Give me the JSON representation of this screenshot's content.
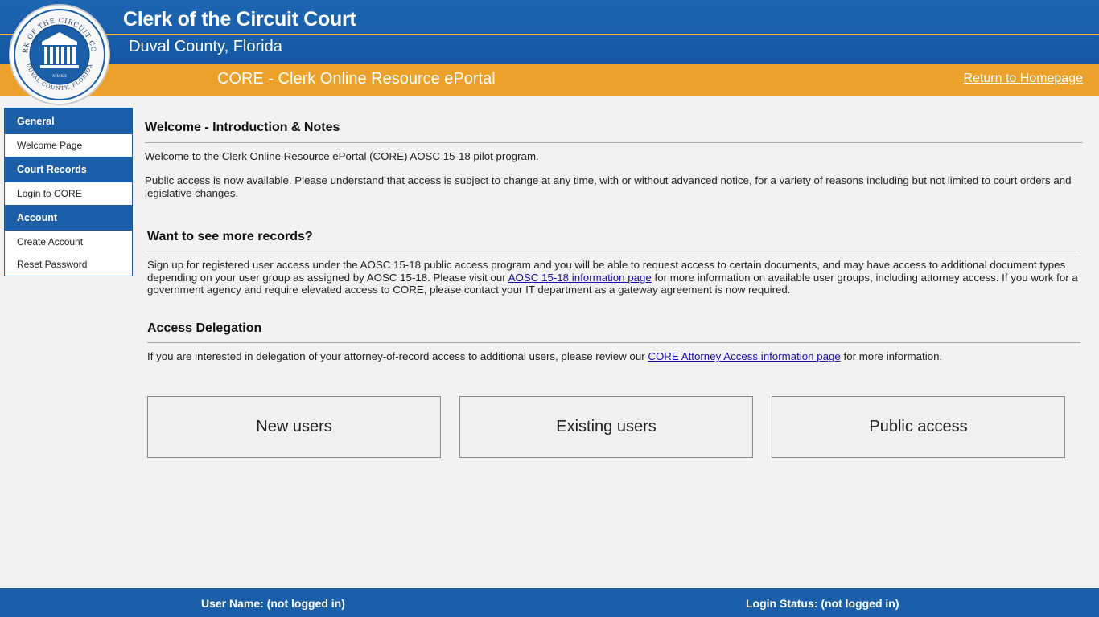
{
  "header": {
    "title": "Clerk of the Circuit Court",
    "subtitle": "Duval County, Florida",
    "portal_title": "CORE - Clerk Online Resource ePortal",
    "home_link": "Return to Homepage",
    "seal_text_top": "CLERK OF THE CIRCUIT COURT",
    "seal_text_bottom": "DUVAL COUNTY, FLORIDA",
    "seal_year": "MMXII"
  },
  "sidebar": {
    "sections": [
      {
        "title": "General",
        "items": [
          "Welcome Page"
        ]
      },
      {
        "title": "Court Records",
        "items": [
          "Login to CORE"
        ]
      },
      {
        "title": "Account",
        "items": [
          "Create Account",
          "Reset Password"
        ]
      }
    ]
  },
  "welcome": {
    "title": "Welcome - Introduction & Notes",
    "p1": "Welcome to the Clerk Online Resource ePortal (CORE) AOSC 15-18 pilot program.",
    "p2": "Public access is now available. Please understand that access is subject to change at any time, with or without advanced notice, for a variety of reasons including but not limited to court orders and legislative changes."
  },
  "records": {
    "title": "Want to see more records?",
    "p_before": "Sign up for registered user access under the AOSC 15-18 public access program and you will be able to request access to certain documents, and may have access to additional document types depending on your user group as assigned by AOSC 15-18. Please visit our ",
    "link": "AOSC 15-18 information page",
    "p_after": " for more information on available user groups, including attorney access. If you work for a government agency and require elevated access to CORE, please contact your IT department as a gateway agreement is now required."
  },
  "delegation": {
    "title": "Access Delegation",
    "p_before": "If you are interested in delegation of your attorney-of-record access to additional users, please review our ",
    "link": "CORE Attorney Access information page",
    "p_after": " for more information."
  },
  "buttons": {
    "new_users": "New users",
    "existing_users": "Existing users",
    "public_access": "Public access"
  },
  "footer": {
    "user_name": "User Name: (not logged in)",
    "login_status": "Login Status: (not logged in)"
  },
  "colors": {
    "brand_blue": "#1a5fa8",
    "accent_orange": "#eca12a",
    "gold_line": "#f0b232"
  }
}
